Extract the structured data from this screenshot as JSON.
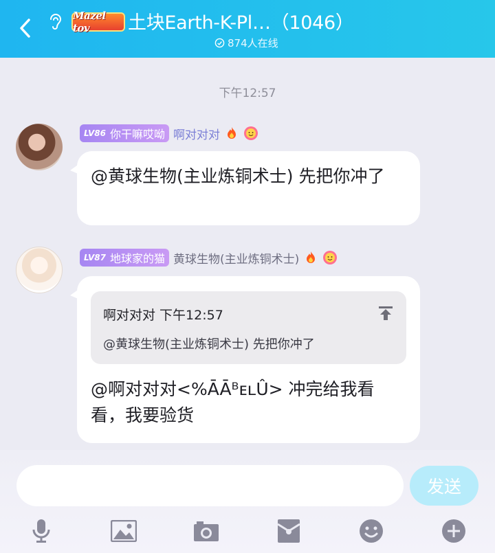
{
  "header": {
    "badge_text": "Mazel tov",
    "title": "土块Earth-K-Pl…（1046）",
    "online": "874人在线",
    "colors": {
      "bar": "#1fb6f0",
      "text": "#ffffff"
    }
  },
  "chat": {
    "time": "下午12:57",
    "messages": [
      {
        "level": "LV86",
        "title_tag": "你干嘛哎呦",
        "nickname": "啊对对对",
        "text": "@黄球生物(主业炼铜术士) 先把你冲了"
      },
      {
        "level": "LV87",
        "title_tag": "地球家的猫",
        "nickname": "黄球生物(主业炼铜术士)",
        "quote": {
          "header": "啊对对对 下午12:57",
          "body": "@黄球生物(主业炼铜术士) 先把你冲了"
        },
        "text": "@啊对对对<%ĀĀᴮᴇʟÛ> 冲完给我看看，我要验货"
      }
    ]
  },
  "composer": {
    "placeholder": "",
    "send_label": "发送"
  },
  "toolbar": {
    "icons": [
      "mic-icon",
      "image-icon",
      "camera-icon",
      "red-packet-icon",
      "emoji-icon",
      "plus-icon"
    ],
    "icon_color": "#8a8a9a"
  }
}
